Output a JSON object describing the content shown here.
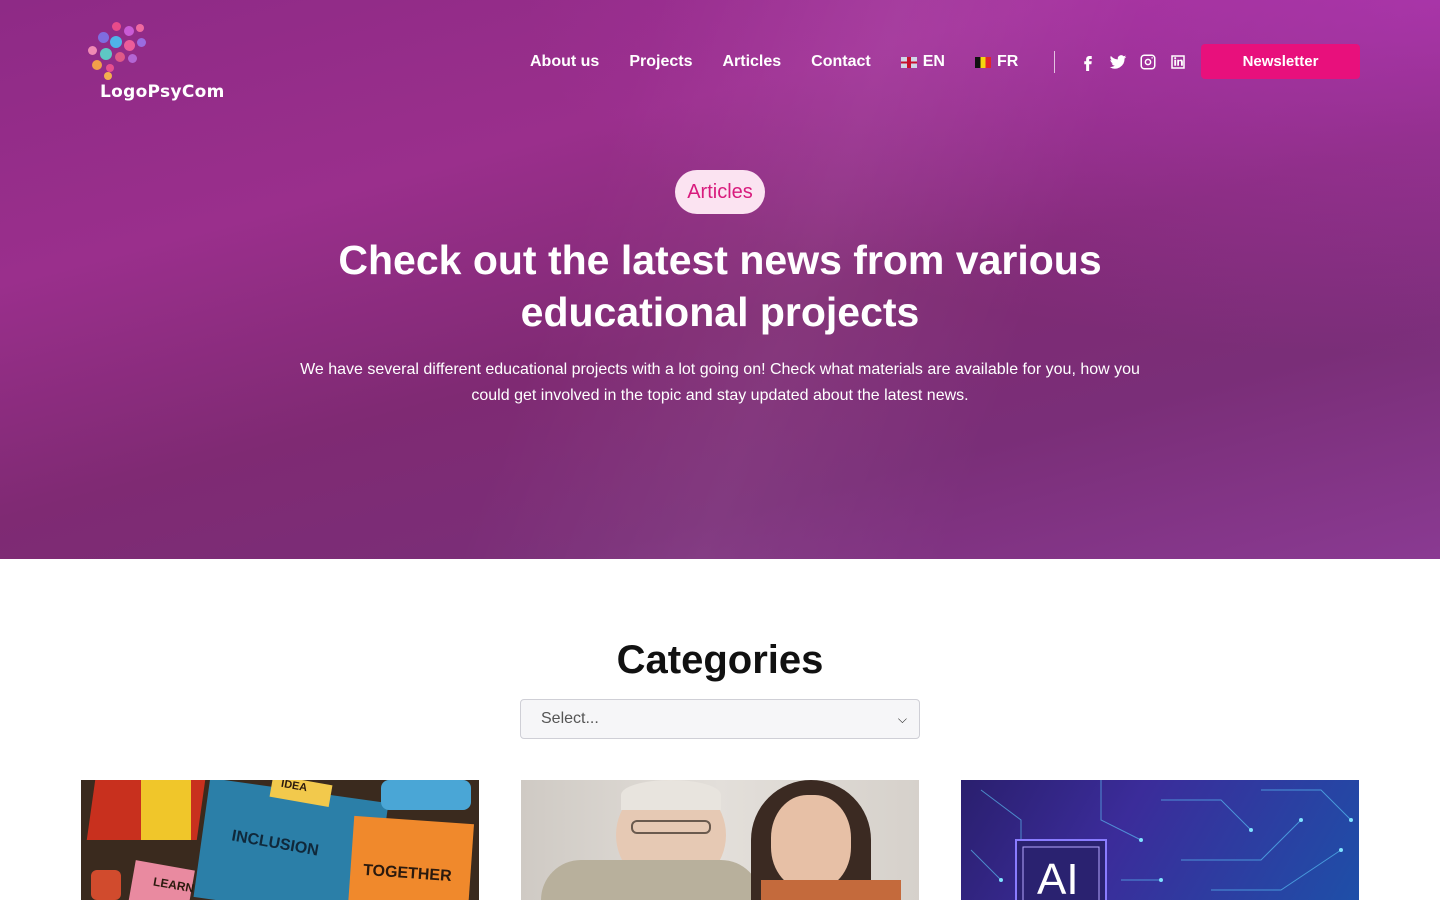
{
  "brand": {
    "name": "LogoPsyCom"
  },
  "nav": {
    "items": [
      {
        "label": "About us"
      },
      {
        "label": "Projects"
      },
      {
        "label": "Articles"
      },
      {
        "label": "Contact"
      }
    ],
    "languages": [
      {
        "code": "EN",
        "flag": "uk-flag-icon"
      },
      {
        "code": "FR",
        "flag": "belgium-flag-icon"
      }
    ],
    "social": [
      "facebook-icon",
      "twitter-icon",
      "instagram-icon",
      "linkedin-icon"
    ],
    "newsletter_label": "Newsletter"
  },
  "hero": {
    "badge": "Articles",
    "title": "Check out the latest news from various educational projects",
    "subtitle": "We have several different educational projects with a lot going on! Check what materials are available for you, how you could get involved in the topic and stay updated about the latest news."
  },
  "categories": {
    "title": "Categories",
    "select_value": "Select..."
  },
  "cards": [
    {
      "image_words": [
        "INCLUSION",
        "TOGETHER",
        "LEARN",
        "IDEA"
      ]
    },
    {
      "image": "elderly-man-and-woman-photo"
    },
    {
      "image_words": [
        "AI"
      ]
    }
  ],
  "colors": {
    "hero_bg": "#8e2a86",
    "accent": "#e8107c",
    "badge_bg": "#fbe3f1",
    "badge_text": "#d81b7d"
  }
}
